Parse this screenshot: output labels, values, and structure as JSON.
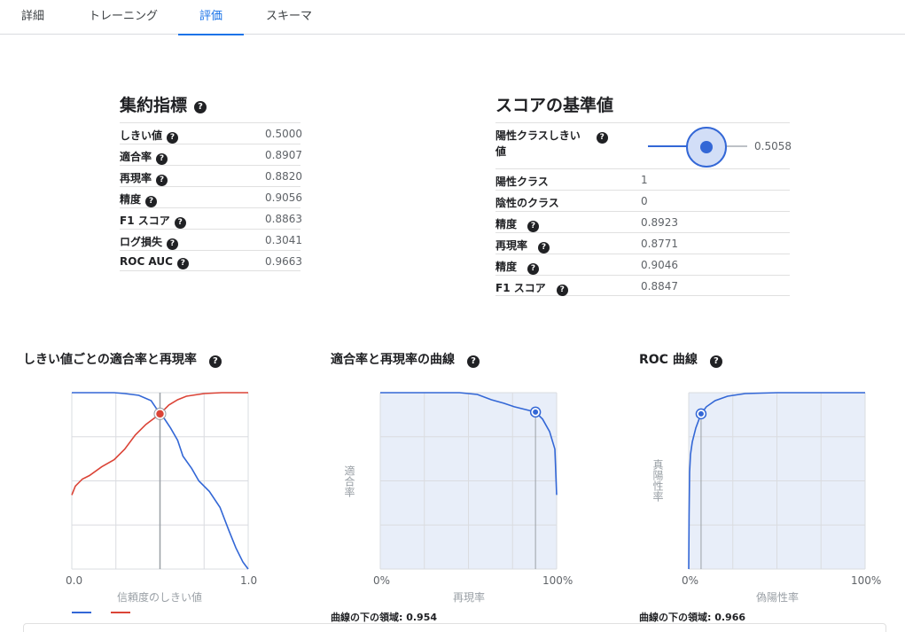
{
  "tabs": [
    {
      "label": "詳細",
      "active": false
    },
    {
      "label": "トレーニング",
      "active": false
    },
    {
      "label": "評価",
      "active": true
    },
    {
      "label": "スキーマ",
      "active": false
    }
  ],
  "summary": {
    "title": "集約指標",
    "rows": [
      {
        "label": "しきい値",
        "value": "0.5000"
      },
      {
        "label": "適合率",
        "value": "0.8907"
      },
      {
        "label": "再現率",
        "value": "0.8820"
      },
      {
        "label": "精度",
        "value": "0.9056"
      },
      {
        "label": "F1 スコア",
        "value": "0.8863"
      },
      {
        "label": "ログ損失",
        "value": "0.3041"
      },
      {
        "label": "ROC AUC",
        "value": "0.9663"
      }
    ]
  },
  "score": {
    "title": "スコアの基準値",
    "threshold_label_line1": "陽性クラスしきい",
    "threshold_label_line2": "値",
    "threshold_value": "0.5058",
    "slider_fraction": 0.5058,
    "rows": [
      {
        "label": "陽性クラス",
        "value": "1",
        "help": false
      },
      {
        "label": "陰性のクラス",
        "value": "0",
        "help": false
      },
      {
        "label": "精度",
        "value": "0.8923",
        "help": true
      },
      {
        "label": "再現率",
        "value": "0.8771",
        "help": true
      },
      {
        "label": "精度",
        "value": "0.9046",
        "help": true
      },
      {
        "label": "F1 スコア",
        "value": "0.8847",
        "help": true
      }
    ]
  },
  "charts": {
    "threshold": {
      "title": "しきい値ごとの適合率と再現率",
      "x_min_label": "0.0",
      "x_max_label": "1.0",
      "xlabel": "信頼度のしきい値",
      "colors": {
        "precision": "#3367d6",
        "recall": "#db4437"
      }
    },
    "pr": {
      "title": "適合率と再現率の曲線",
      "x_min_label": "0%",
      "x_max_label": "100%",
      "xlabel": "再現率",
      "ylabel": "適合率",
      "auc": "曲線の下の領域: 0.954"
    },
    "roc": {
      "title": "ROC 曲線",
      "x_min_label": "0%",
      "x_max_label": "100%",
      "xlabel": "偽陽性率",
      "ylabel": "真陽性率",
      "auc": "曲線の下の領域: 0.966"
    }
  },
  "chart_data": [
    {
      "type": "line",
      "xlim": [
        0,
        1
      ],
      "ylim": [
        0,
        1
      ],
      "grid": true,
      "marker_x": 0.5,
      "series": [
        {
          "points": [
            [
              0,
              1
            ],
            [
              0.24,
              1
            ],
            [
              0.3,
              0.995
            ],
            [
              0.38,
              0.985
            ],
            [
              0.45,
              0.955
            ],
            [
              0.5,
              0.88
            ],
            [
              0.52,
              0.86
            ],
            [
              0.56,
              0.8
            ],
            [
              0.6,
              0.73
            ],
            [
              0.63,
              0.64
            ],
            [
              0.68,
              0.57
            ],
            [
              0.72,
              0.5
            ],
            [
              0.78,
              0.44
            ],
            [
              0.84,
              0.35
            ],
            [
              0.89,
              0.22
            ],
            [
              0.93,
              0.12
            ],
            [
              0.97,
              0.04
            ],
            [
              1,
              0
            ]
          ],
          "color": "#3367d6"
        },
        {
          "points": [
            [
              0,
              0.42
            ],
            [
              0.02,
              0.47
            ],
            [
              0.06,
              0.51
            ],
            [
              0.1,
              0.53
            ],
            [
              0.17,
              0.58
            ],
            [
              0.24,
              0.62
            ],
            [
              0.3,
              0.68
            ],
            [
              0.36,
              0.76
            ],
            [
              0.42,
              0.82
            ],
            [
              0.5,
              0.88
            ],
            [
              0.55,
              0.93
            ],
            [
              0.6,
              0.96
            ],
            [
              0.65,
              0.98
            ],
            [
              0.75,
              0.995
            ],
            [
              0.85,
              1
            ],
            [
              1,
              1
            ]
          ],
          "color": "#db4437"
        }
      ]
    },
    {
      "type": "area",
      "xlim": [
        0,
        1
      ],
      "ylim": [
        0,
        1
      ],
      "grid": true,
      "marker": [
        0.88,
        0.89
      ],
      "series": [
        {
          "points": [
            [
              0,
              1
            ],
            [
              0.45,
              1
            ],
            [
              0.55,
              0.99
            ],
            [
              0.63,
              0.96
            ],
            [
              0.7,
              0.94
            ],
            [
              0.76,
              0.92
            ],
            [
              0.82,
              0.905
            ],
            [
              0.88,
              0.89
            ],
            [
              0.92,
              0.85
            ],
            [
              0.96,
              0.78
            ],
            [
              0.99,
              0.68
            ],
            [
              1,
              0.42
            ]
          ],
          "color": "#3367d6"
        }
      ]
    },
    {
      "type": "area",
      "xlim": [
        0,
        1
      ],
      "ylim": [
        0,
        1
      ],
      "grid": true,
      "marker": [
        0.07,
        0.88
      ],
      "series": [
        {
          "points": [
            [
              0,
              0
            ],
            [
              0.002,
              0.3
            ],
            [
              0.005,
              0.55
            ],
            [
              0.01,
              0.65
            ],
            [
              0.02,
              0.72
            ],
            [
              0.04,
              0.8
            ],
            [
              0.07,
              0.88
            ],
            [
              0.1,
              0.92
            ],
            [
              0.15,
              0.955
            ],
            [
              0.22,
              0.98
            ],
            [
              0.32,
              0.995
            ],
            [
              0.5,
              1
            ],
            [
              1,
              1
            ]
          ],
          "color": "#3367d6"
        }
      ]
    }
  ]
}
